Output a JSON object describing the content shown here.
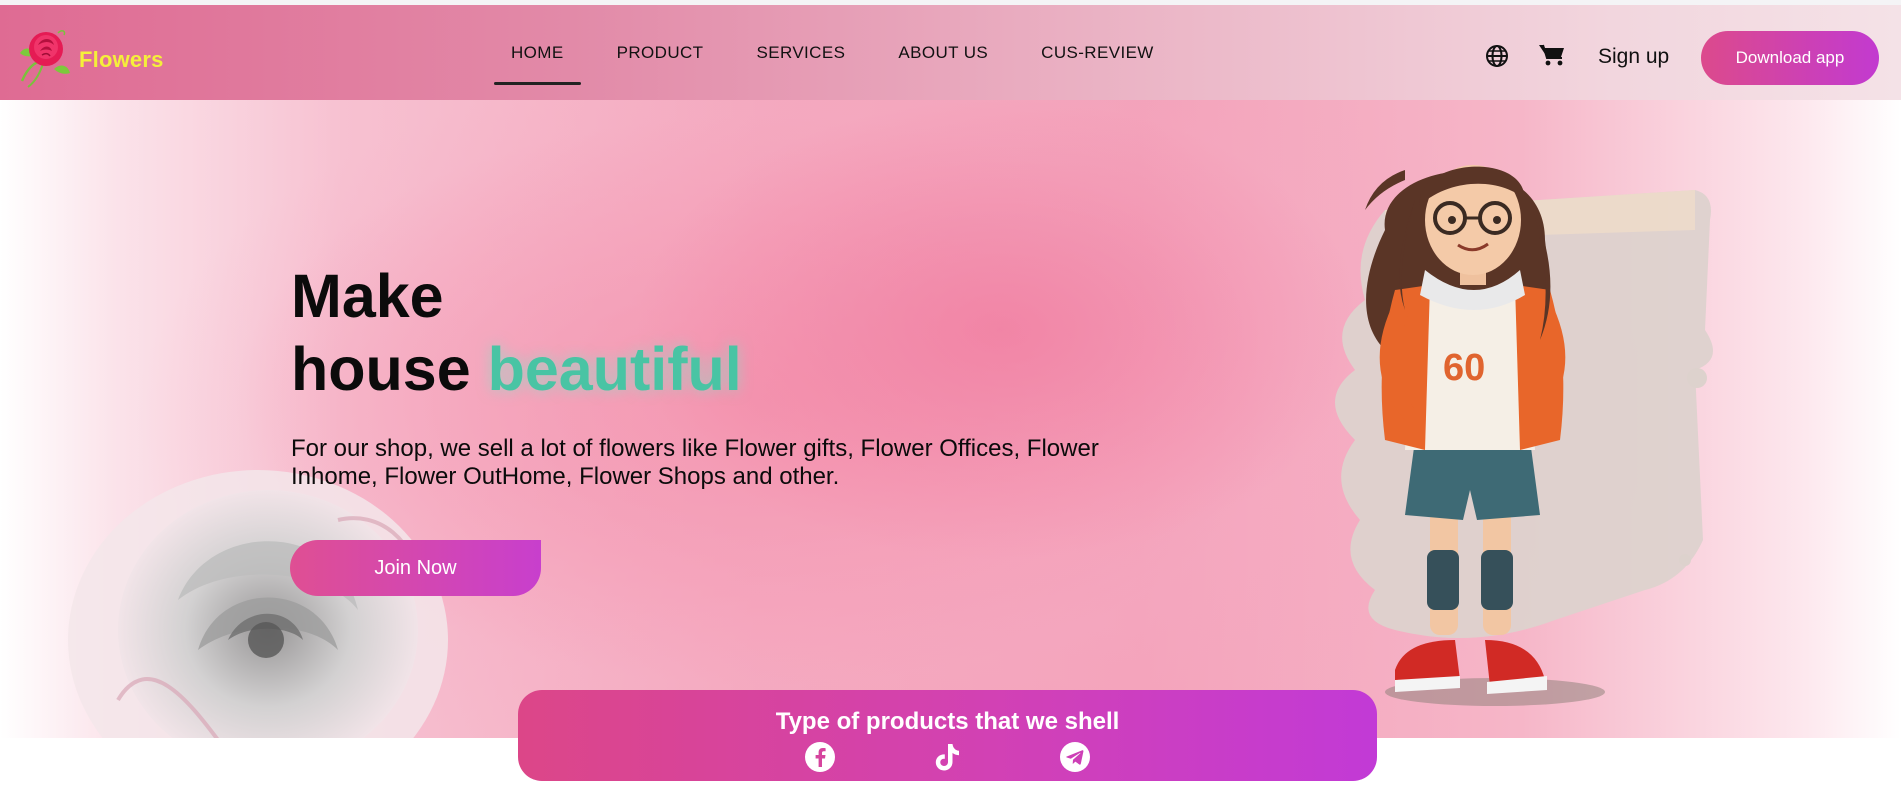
{
  "brand": {
    "name": "Flowers",
    "logo_icon": "rose-logo-icon"
  },
  "nav": {
    "items": [
      {
        "label": "HOME",
        "active": true
      },
      {
        "label": "PRODUCT",
        "active": false
      },
      {
        "label": "SERVICES",
        "active": false
      },
      {
        "label": "ABOUT US",
        "active": false
      },
      {
        "label": "CUS-REVIEW",
        "active": false
      }
    ],
    "icons": [
      "globe-icon",
      "cart-icon"
    ],
    "signup_label": "Sign up",
    "download_label": "Download app"
  },
  "hero": {
    "headline_line1": "Make",
    "headline_line2_plain": "house",
    "headline_line2_accent": "beautiful",
    "description": "For our shop, we sell a lot of flowers like Flower gifts, Flower Offices, Flower Inhome, Flower OutHome, Flower Shops and other.",
    "cta_label": "Join Now"
  },
  "products_banner": {
    "title": "Type of products that we shell",
    "social_icons": [
      "facebook-icon",
      "tiktok-icon",
      "telegram-icon"
    ]
  },
  "colors": {
    "accent_green": "#49c4a4",
    "brand_pink": "#dc4a8c",
    "brand_purple": "#c23ad0",
    "logo_yellow": "#f5ef3a"
  }
}
